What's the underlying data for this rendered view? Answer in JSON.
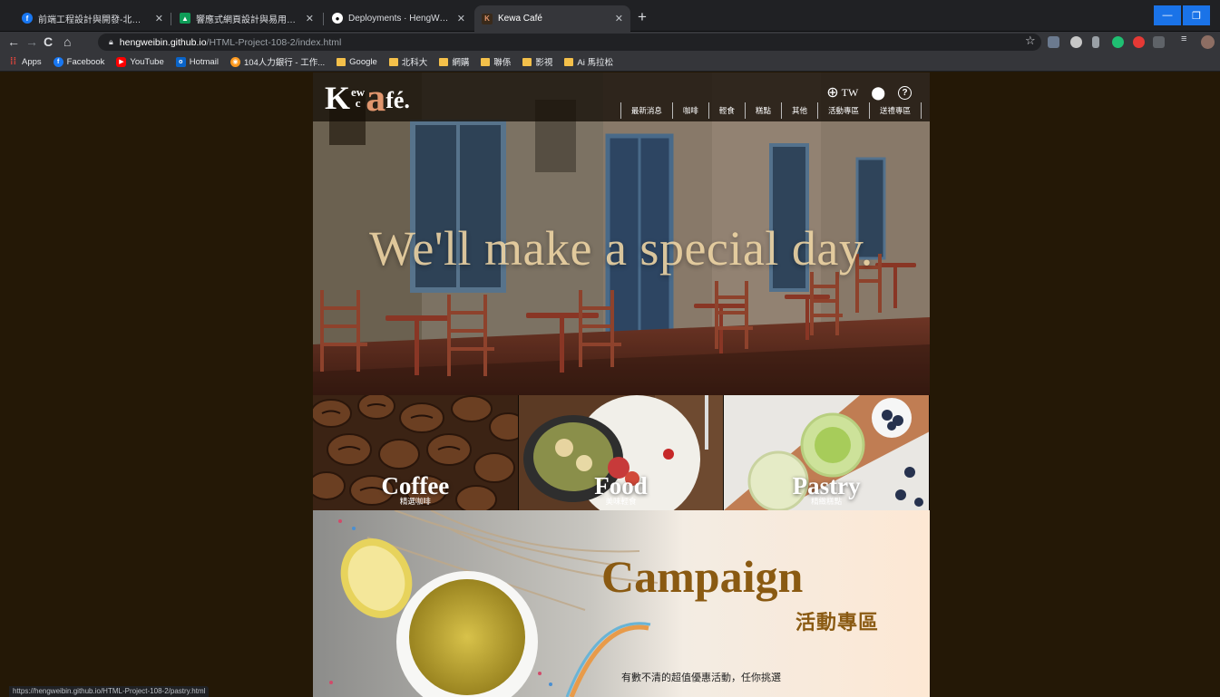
{
  "browser": {
    "tabs": [
      {
        "title": "前端工程設計與開發-北科資工 | ",
        "favicon": "facebook-icon",
        "color": "#1877f2"
      },
      {
        "title": "響應式網頁設計與易用性 - Goog",
        "favicon": "google-drive-icon",
        "color": "#f4b400"
      },
      {
        "title": "Deployments · HengWeiBin/HTM",
        "favicon": "github-icon",
        "color": "#ffffff"
      },
      {
        "title": "Kewa Café",
        "favicon": "kewa-icon",
        "color": "#e0956d"
      }
    ],
    "url_host": "hengweibin.github.io",
    "url_path": "/HTML-Project-108-2/index.html",
    "bookmarks": [
      {
        "label": "Apps",
        "icon": "apps-grid-icon",
        "color": "#e8453c"
      },
      {
        "label": "Facebook",
        "icon": "facebook-icon",
        "color": "#1877f2"
      },
      {
        "label": "YouTube",
        "icon": "youtube-icon",
        "color": "#ff0000"
      },
      {
        "label": "Hotmail",
        "icon": "outlook-icon",
        "color": "#0a64c8"
      },
      {
        "label": "104人力銀行 - 工作...",
        "icon": "104-icon",
        "color": "#ff9a1f"
      },
      {
        "label": "Google",
        "icon": "folder-icon",
        "color": "#f4c04a"
      },
      {
        "label": "北科大",
        "icon": "folder-icon",
        "color": "#f4c04a"
      },
      {
        "label": "網購",
        "icon": "folder-icon",
        "color": "#f4c04a"
      },
      {
        "label": "聯係",
        "icon": "folder-icon",
        "color": "#f4c04a"
      },
      {
        "label": "影視",
        "icon": "folder-icon",
        "color": "#f4c04a"
      },
      {
        "label": "Ai 馬拉松",
        "icon": "folder-icon",
        "color": "#f4c04a"
      }
    ],
    "status_url": "https://hengweibin.github.io/HTML-Project-108-2/pastry.html"
  },
  "site": {
    "logo": {
      "k": "K",
      "ew": "ew",
      "c": "c",
      "a": "a",
      "fe": "fé."
    },
    "lang": "TW",
    "menu": [
      "最新消息",
      "咖啡",
      "輕食",
      "糕點",
      "其他",
      "活動專區",
      "送禮專區"
    ],
    "hero_text": "We'll make a special day.",
    "categories": [
      {
        "title": "Coffee",
        "sub": "精選咖啡"
      },
      {
        "title": "Food",
        "sub": "美味輕食"
      },
      {
        "title": "Pastry",
        "sub": "精緻糕點"
      }
    ],
    "campaign": {
      "title": "Campaign",
      "sub": "活動專區",
      "desc": "有數不清的超值優惠活動，任你挑選"
    }
  },
  "colors": {
    "accent": "#8a5a12",
    "logo_a": "#e0956d",
    "hero_text": "#ecd3a3",
    "page_bg": "#241806"
  }
}
